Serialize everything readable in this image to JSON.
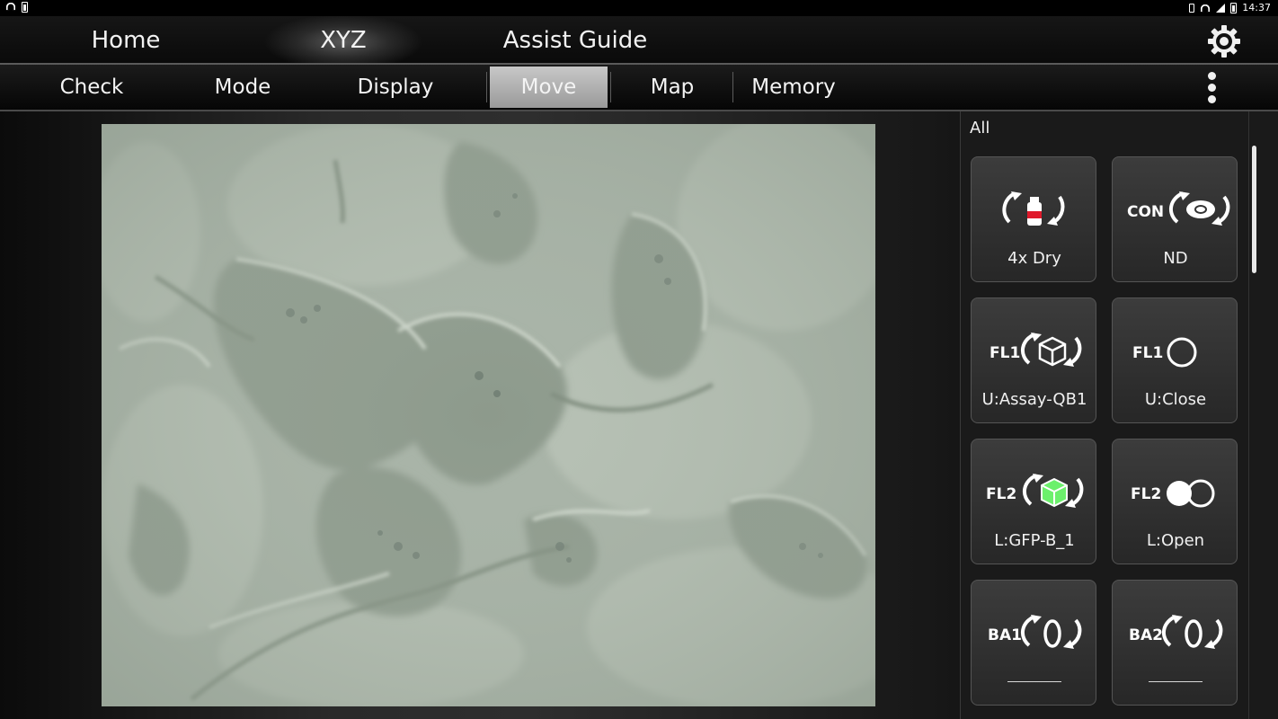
{
  "status_bar": {
    "time": "14:37"
  },
  "top_nav": {
    "tabs": [
      {
        "label": "Home",
        "active": false
      },
      {
        "label": "XYZ",
        "active": true
      },
      {
        "label": "Assist Guide",
        "active": false
      }
    ],
    "settings_icon": "gear-icon"
  },
  "sub_nav": {
    "tabs": [
      {
        "label": "Check",
        "disabled": true
      },
      {
        "label": "Mode"
      },
      {
        "label": "Display"
      },
      {
        "label": "Move",
        "selected": true
      },
      {
        "label": "Map"
      },
      {
        "label": "Memory"
      }
    ],
    "overflow_icon": "more-vertical-icon"
  },
  "panel": {
    "title": "All",
    "cards": [
      {
        "prefix": "",
        "label": "4x Dry",
        "icon": "objective-rotate-icon"
      },
      {
        "prefix": "CON",
        "label": "ND",
        "icon": "condenser-rotate-icon"
      },
      {
        "prefix": "FL1",
        "label": "U:Assay-QB1",
        "icon": "filter-cube-rotate-icon"
      },
      {
        "prefix": "FL1",
        "label": "U:Close",
        "icon": "shutter-closed-icon"
      },
      {
        "prefix": "FL2",
        "label": "L:GFP-B_1",
        "icon": "gfp-cube-rotate-icon"
      },
      {
        "prefix": "FL2",
        "label": "L:Open",
        "icon": "shutter-open-icon"
      },
      {
        "prefix": "BA1",
        "label": "",
        "icon": "barrier-rotate-icon"
      },
      {
        "prefix": "BA2",
        "label": "",
        "icon": "barrier-rotate-icon"
      }
    ]
  },
  "colors": {
    "selected_tab_bg": "#b4b4b4",
    "disabled_text": "#6a6a6a",
    "card_bg": "#333333",
    "objective_red": "#e0192b",
    "gfp_green": "#6cf06c"
  }
}
